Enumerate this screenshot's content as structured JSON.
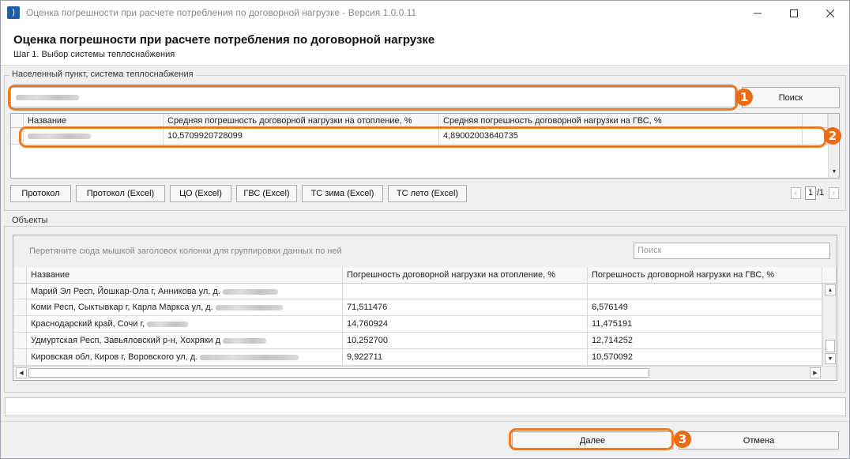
{
  "window": {
    "title": "Оценка погрешности при расчете потребления по договорной нагрузке - Версия 1.0.0.11",
    "icon": "app-logo-icon",
    "controls": [
      "minimize-icon",
      "maximize-icon",
      "close-icon"
    ]
  },
  "header": {
    "title": "Оценка погрешности при расчете потребления по договорной нагрузке",
    "step": "Шаг 1. Выбор системы теплоснабжения"
  },
  "settlement": {
    "legend": "Населенный пункт, система теплоснабжения",
    "search_value": "",
    "search_button": "Поиск",
    "columns": [
      "Название",
      "Средняя погрешность договорной нагрузки на отопление, %",
      "Средняя погрешность договорной нагрузки на ГВС, %"
    ],
    "rows": [
      {
        "name": "",
        "heating": "10,5709920728099",
        "gvs": "4,89002003640735"
      }
    ]
  },
  "reports": {
    "buttons": [
      "Протокол",
      "Протокол (Excel)",
      "ЦО (Excel)",
      "ГВС (Excel)",
      "ТС зима (Excel)",
      "ТС лето (Excel)"
    ],
    "page_current": "1",
    "page_total": "/1"
  },
  "objects": {
    "legend": "Объекты",
    "group_hint": "Перетяните сюда мышкой заголовок колонки для группировки данных по ней",
    "search_placeholder": "Поиск",
    "columns": [
      "Название",
      "Погрешность договорной нагрузки на отопление, %",
      "Погрешность договорной нагрузки на ГВС, %"
    ],
    "rows": [
      {
        "name": "Марий Эл Респ, Йошкар-Ола г, Анникова ул, д.",
        "heating": "",
        "gvs": ""
      },
      {
        "name": "Коми Респ, Сыктывкар г, Карла Маркса ул, д.",
        "heating": "71,511476",
        "gvs": "6,576149"
      },
      {
        "name": "Краснодарский край, Сочи г,",
        "heating": "14,760924",
        "gvs": "11,475191"
      },
      {
        "name": "Удмуртская Респ, Завьяловский р-н, Хохряки д",
        "heating": "10,252700",
        "gvs": "12,714252"
      },
      {
        "name": "Кировская обл, Киров г, Воровского ул, д.",
        "heating": "9,922711",
        "gvs": "10,570092"
      }
    ]
  },
  "status": {
    "text": ""
  },
  "footer": {
    "next_button": "Далее",
    "cancel_button": "Отмена"
  },
  "callouts": [
    "1",
    "2",
    "3"
  ],
  "colors": {
    "callout": "#f07a1e",
    "badge": "#ea6b12",
    "app_icon": "#1f5fa8"
  }
}
